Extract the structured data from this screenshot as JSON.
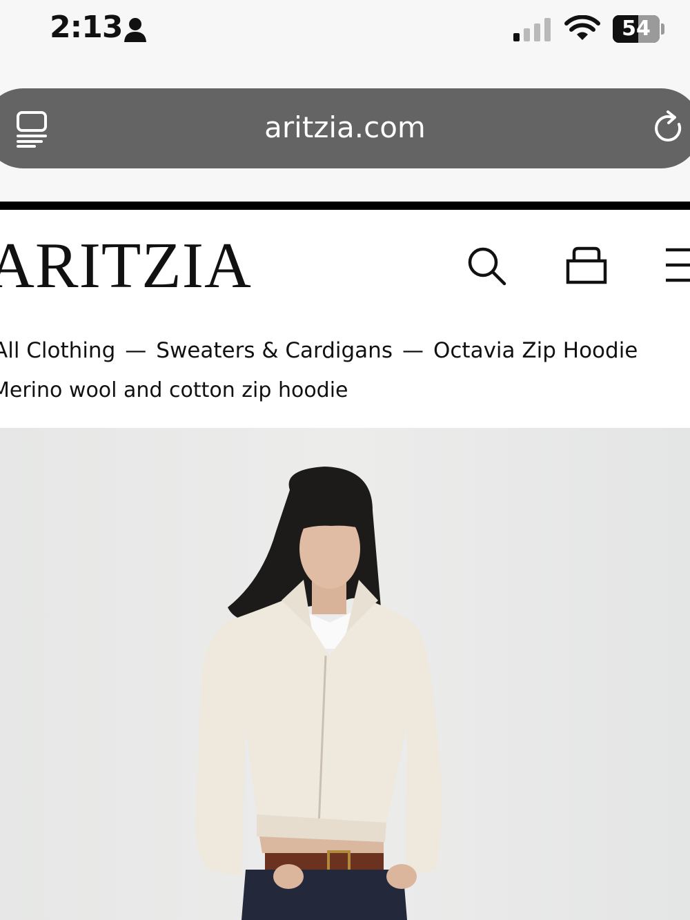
{
  "status_bar": {
    "time": "2:13",
    "battery_level": "54",
    "icons": [
      "person-icon",
      "signal-icon",
      "wifi-icon",
      "battery-icon"
    ]
  },
  "browser": {
    "url": "aritzia.com",
    "left_icon": "tabs-icon",
    "right_icon": "reload-icon",
    "urlbar_color": "#646464"
  },
  "header": {
    "logo": "ARITZIA",
    "icons": [
      "search-icon",
      "bag-icon",
      "menu-icon"
    ]
  },
  "breadcrumb": {
    "items": [
      "All Clothing",
      "Sweaters & Cardigans",
      "Octavia Zip Hoodie"
    ],
    "separator": "—"
  },
  "product": {
    "subtitle": "Merino wool and cotton zip hoodie",
    "image_description_icon": "product-photo"
  }
}
